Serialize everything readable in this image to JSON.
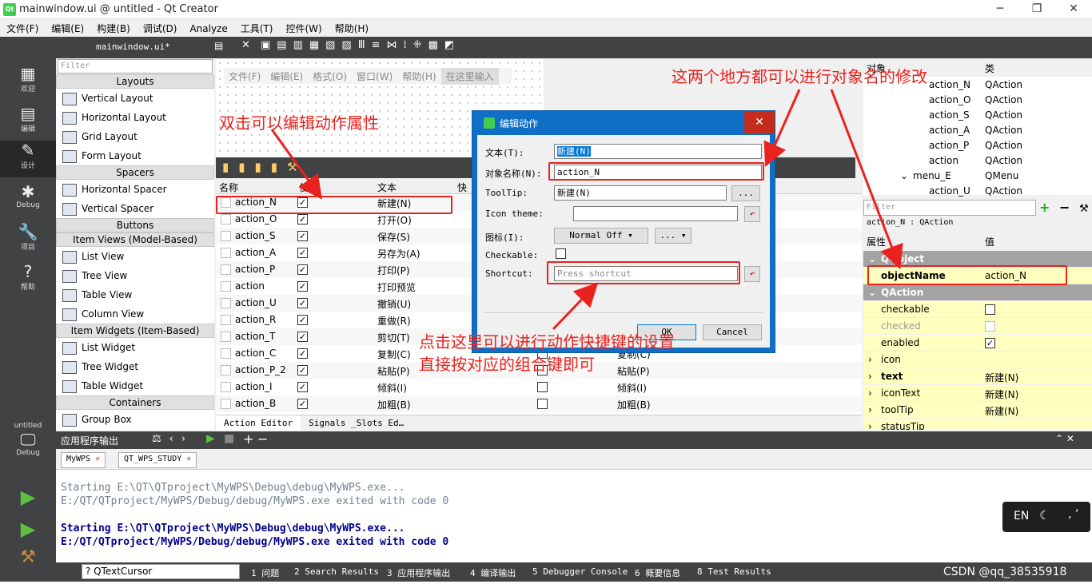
{
  "window": {
    "title": "mainwindow.ui @ untitled - Qt Creator",
    "min": "─",
    "max": "❐",
    "close": "✕"
  },
  "menubar": [
    "文件(F)",
    "编辑(E)",
    "构建(B)",
    "调试(D)",
    "Analyze",
    "工具(T)",
    "控件(W)",
    "帮助(H)"
  ],
  "modes": [
    {
      "label": "欢迎",
      "icon": "▦"
    },
    {
      "label": "编辑",
      "icon": "▤"
    },
    {
      "label": "设计",
      "icon": "✎"
    },
    {
      "label": "Debug",
      "icon": "✱"
    },
    {
      "label": "项目",
      "icon": "🔧"
    },
    {
      "label": "帮助",
      "icon": "?"
    }
  ],
  "kit": {
    "project": "untitled",
    "config": "Debug"
  },
  "doc": {
    "file": "mainwindow.ui*"
  },
  "widgetbox": {
    "filter_placeholder": "Filter",
    "sections": [
      {
        "title": "Layouts",
        "items": [
          "Vertical Layout",
          "Horizontal Layout",
          "Grid Layout",
          "Form Layout"
        ]
      },
      {
        "title": "Spacers",
        "items": [
          "Horizontal Spacer",
          "Vertical Spacer"
        ]
      },
      {
        "title": "Buttons",
        "items": []
      },
      {
        "title": "Item Views (Model-Based)",
        "items": [
          "List View",
          "Tree View",
          "Table View",
          "Column View"
        ]
      },
      {
        "title": "Item Widgets (Item-Based)",
        "items": [
          "List Widget",
          "Tree Widget",
          "Table Widget"
        ]
      },
      {
        "title": "Containers",
        "items": [
          "Group Box"
        ]
      }
    ]
  },
  "formmenu": [
    "文件(F)",
    "编辑(E)",
    "格式(O)",
    "窗口(W)",
    "帮助(H)",
    "在这里输入"
  ],
  "action_editor": {
    "headers": [
      "名称",
      "使用",
      "文本",
      "快"
    ],
    "rows": [
      {
        "name": "action_N",
        "text": "新建(N)"
      },
      {
        "name": "action_O",
        "text": "打开(O)"
      },
      {
        "name": "action_S",
        "text": "保存(S)"
      },
      {
        "name": "action_A",
        "text": "另存为(A)"
      },
      {
        "name": "action_P",
        "text": "打印(P)"
      },
      {
        "name": "action",
        "text": "打印预览"
      },
      {
        "name": "action_U",
        "text": "撤销(U)"
      },
      {
        "name": "action_R",
        "text": "重做(R)"
      },
      {
        "name": "action_T",
        "text": "剪切(T)"
      },
      {
        "name": "action_C",
        "text": "复制(C)",
        "tip": "复制(C)"
      },
      {
        "name": "action_P_2",
        "text": "粘贴(P)",
        "tip": "粘贴(P)"
      },
      {
        "name": "action_I",
        "text": "倾斜(I)",
        "tip": "倾斜(I)"
      },
      {
        "name": "action_B",
        "text": "加粗(B)",
        "tip": "加粗(B)"
      }
    ],
    "tabs": [
      "Action Editor",
      "Signals _Slots Ed…"
    ]
  },
  "object_inspector": {
    "headers": [
      "对象",
      "类"
    ],
    "rows": [
      {
        "name": "action_N",
        "cls": "QAction",
        "indent": 1
      },
      {
        "name": "action_O",
        "cls": "QAction",
        "indent": 1
      },
      {
        "name": "action_S",
        "cls": "QAction",
        "indent": 1
      },
      {
        "name": "action_A",
        "cls": "QAction",
        "indent": 1
      },
      {
        "name": "action_P",
        "cls": "QAction",
        "indent": 1
      },
      {
        "name": "action",
        "cls": "QAction",
        "indent": 1
      },
      {
        "name": "menu_E",
        "cls": "QMenu",
        "indent": 0
      },
      {
        "name": "action_U",
        "cls": "QAction",
        "indent": 1
      }
    ]
  },
  "property_editor": {
    "filter_placeholder": "Filter",
    "object": "action_N : QAction",
    "headers": [
      "属性",
      "值"
    ],
    "rows": [
      {
        "kind": "group",
        "name": "QObject"
      },
      {
        "kind": "prop",
        "name": "objectName",
        "value": "action_N",
        "bold": true
      },
      {
        "kind": "group",
        "name": "QAction"
      },
      {
        "kind": "check",
        "name": "checkable",
        "checked": false
      },
      {
        "kind": "check",
        "name": "checked",
        "checked": false,
        "disabled": true
      },
      {
        "kind": "check",
        "name": "enabled",
        "checked": true
      },
      {
        "kind": "prop",
        "name": "icon",
        "value": "",
        "expand": true
      },
      {
        "kind": "prop",
        "name": "text",
        "value": "新建(N)",
        "expand": true,
        "bold": true
      },
      {
        "kind": "prop",
        "name": "iconText",
        "value": "新建(N)",
        "expand": true
      },
      {
        "kind": "prop",
        "name": "toolTip",
        "value": "新建(N)",
        "expand": true
      },
      {
        "kind": "prop",
        "name": "statusTip",
        "value": "",
        "expand": true
      }
    ]
  },
  "dialog": {
    "title": "编辑动作",
    "text_label": "文本(T):",
    "text_value": "新建(N)",
    "objname_label": "对象名称(N):",
    "objname_value": "action_N",
    "tooltip_label": "ToolTip:",
    "tooltip_value": "新建(N)",
    "tooltip_btn": "...",
    "icontheme_label": "Icon theme:",
    "icon_label": "图标(I):",
    "icon_mode": "Normal Off",
    "icon_btn": "...",
    "checkable_label": "Checkable:",
    "shortcut_label": "Shortcut:",
    "shortcut_placeholder": "Press shortcut",
    "ok": "OK",
    "cancel": "Cancel"
  },
  "output": {
    "title": "应用程序输出",
    "tabs": [
      "MyWPS",
      "QT_WPS_STUDY"
    ],
    "lines": [
      {
        "text": "Starting E:\\QT\\QTproject\\MyWPS\\Debug\\debug\\MyWPS.exe...",
        "style": "old"
      },
      {
        "text": "E:/QT/QTproject/MyWPS/Debug/debug/MyWPS.exe exited with code 0",
        "style": "old"
      },
      {
        "text": "",
        "style": "old"
      },
      {
        "text": "Starting E:\\QT\\QTproject\\MyWPS\\Debug\\debug\\MyWPS.exe...",
        "style": "new"
      },
      {
        "text": "E:/QT/QTproject/MyWPS/Debug/debug/MyWPS.exe exited with code 0",
        "style": "new"
      }
    ]
  },
  "statusbar": {
    "locator": "? QTextCursor",
    "panes": [
      "1 问题",
      "2 Search Results",
      "3 应用程序输出",
      "4 编译输出",
      "5 Debugger Console",
      "6 概要信息",
      "8 Test Results"
    ]
  },
  "ime": {
    "lang": "EN"
  },
  "watermark": "CSDN @qq_38535918",
  "annotations": {
    "a1": "双击可以编辑动作属性",
    "a2": "这两个地方都可以进行对象名的修改",
    "a3": "点击这里可以进行动作快捷键的设置",
    "a4": "直接按对应的组合键即可"
  },
  "colors": {
    "annotation": "#e8231f",
    "dark_panel": "#404244",
    "dialog_blue": "#0f6fc6",
    "output_new": "#00008b",
    "output_old": "#708090",
    "prop_yellow": "#ffffbf"
  }
}
